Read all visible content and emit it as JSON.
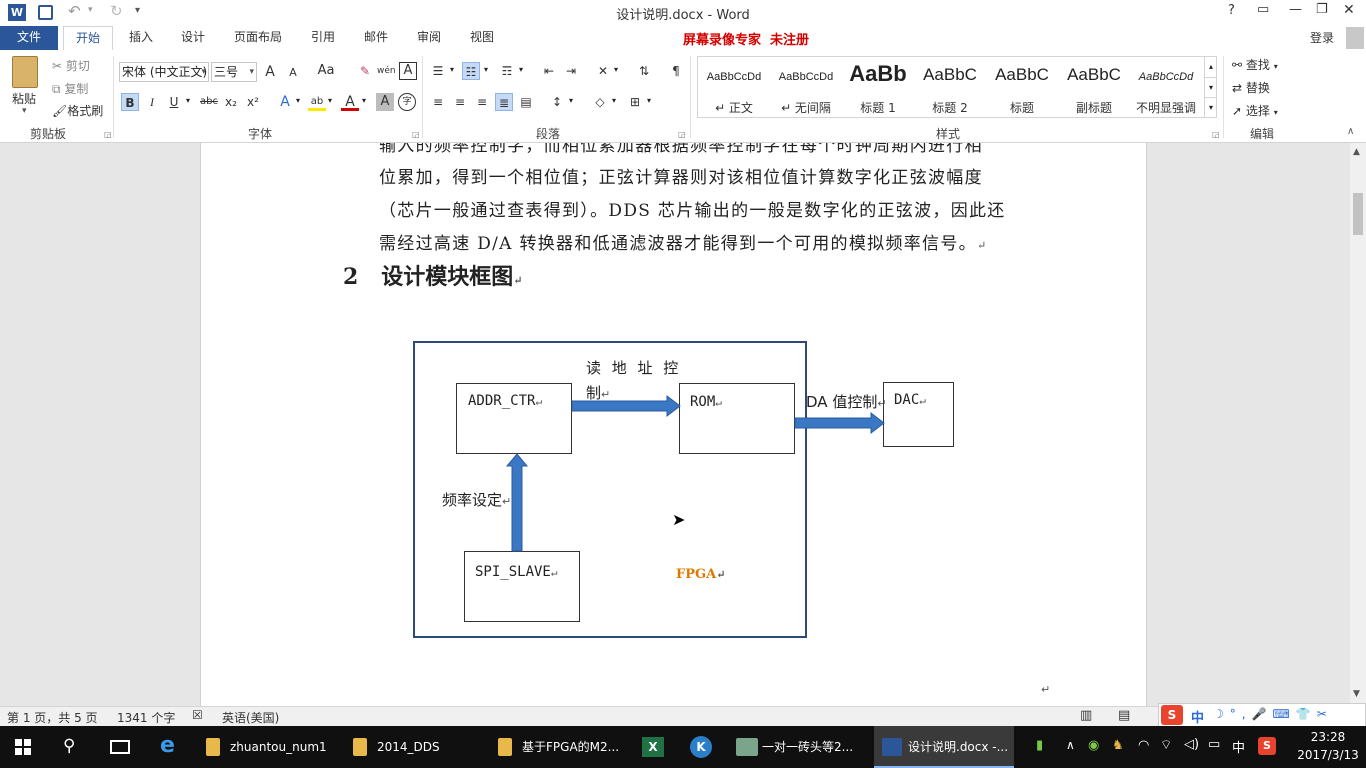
{
  "window": {
    "title": "设计说明.docx - Word",
    "help": "?",
    "restore": "▭",
    "minimize": "—",
    "maximize": "❐",
    "close": "✕"
  },
  "qat": {
    "word_icon": "W",
    "save": "💾",
    "undo": "↶",
    "redo": "↻",
    "more": "▾"
  },
  "tabs": [
    {
      "label": "文件"
    },
    {
      "label": "开始"
    },
    {
      "label": "插入"
    },
    {
      "label": "设计"
    },
    {
      "label": "页面布局"
    },
    {
      "label": "引用"
    },
    {
      "label": "邮件"
    },
    {
      "label": "审阅"
    },
    {
      "label": "视图"
    }
  ],
  "watermark": "屏幕录像专家  未注册",
  "login": "登录",
  "clipboard": {
    "paste": "粘贴",
    "cut": "剪切",
    "copy": "复制",
    "format_painter": "格式刷",
    "group": "剪贴板"
  },
  "font": {
    "name": "宋体 (中文正文)",
    "size": "三号",
    "grow": "A",
    "shrink": "A",
    "case": "Aa",
    "bold": "B",
    "italic": "I",
    "underline": "U",
    "strike": "abc",
    "sub": "x₂",
    "sup": "x²",
    "effects": "A",
    "highlight": "ab",
    "color": "A",
    "shading": "A",
    "phonetic": "wén",
    "border": "A",
    "enclose": "字",
    "group": "字体"
  },
  "paragraph": {
    "group": "段落"
  },
  "styles": {
    "group": "样式",
    "items": [
      {
        "sample": "AaBbCcDd",
        "name": "↵ 正文"
      },
      {
        "sample": "AaBbCcDd",
        "name": "↵ 无间隔"
      },
      {
        "sample": "AaBb",
        "name": "标题 1"
      },
      {
        "sample": "AaBbC",
        "name": "标题 2"
      },
      {
        "sample": "AaBbC",
        "name": "标题"
      },
      {
        "sample": "AaBbC",
        "name": "副标题"
      },
      {
        "sample": "AaBbCcDd",
        "name": "不明显强调"
      }
    ]
  },
  "editing": {
    "find": "查找",
    "replace": "替换",
    "select": "选择",
    "group": "编辑"
  },
  "document": {
    "lines": [
      "输入的频率控制字，而相位累加器根据频率控制字在每个时钟周期内进行相",
      "位累加，得到一个相位值；正弦计算器则对该相位值计算数字化正弦波幅度",
      "（芯片一般通过查表得到）。DDS 芯片输出的一般是数字化的正弦波，因此还",
      "需经过高速 D/A 转换器和低通滤波器才能得到一个可用的模拟频率信号。"
    ],
    "heading": "2   设计模块框图",
    "diagram": {
      "addr": "ADDR_CTR",
      "rom": "ROM",
      "dac": "DAC",
      "spi": "SPI_SLAVE",
      "read_label_1": "读 地 址 控",
      "read_label_2": "制",
      "da_label": "DA 值控制",
      "freq_label": "频率设定",
      "fpga": "FPGA"
    },
    "para_mark": "↵"
  },
  "status": {
    "page": "第 1 页，共 5 页",
    "words": "1341 个字",
    "lang": "英语(美国)"
  },
  "taskbar": {
    "items": [
      {
        "label": "zhuantou_num1"
      },
      {
        "label": "2014_DDS"
      },
      {
        "label": "基于FPGA的M2..."
      },
      {
        "label": "一对一砖头等2..."
      },
      {
        "label": "设计说明.docx -..."
      }
    ],
    "ime": "中",
    "time": "23:28",
    "date": "2017/3/13"
  },
  "colors": {
    "word_blue": "#2b579a",
    "watermark_red": "#d40000",
    "arrow_blue": "#3a78c3",
    "fpga_orange": "#e07800",
    "taskbar": "#101010"
  }
}
